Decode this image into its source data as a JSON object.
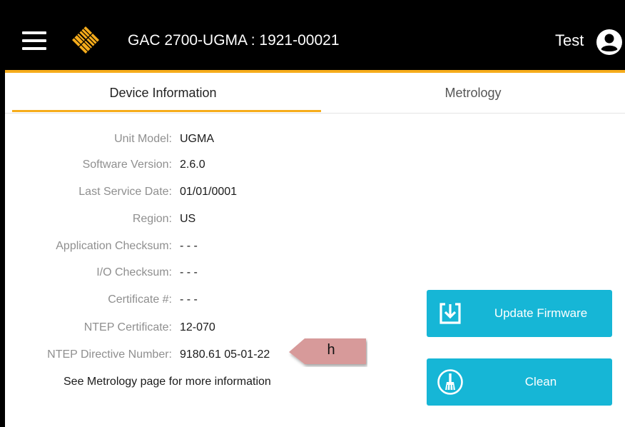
{
  "header": {
    "title": "GAC 2700-UGMA : 1921-00021",
    "user": "Test",
    "menu_icon": "hamburger-menu-icon",
    "logo_icon": "gac-logo-icon",
    "user_icon": "user-account-icon",
    "accent_color": "#f6ac1b"
  },
  "tabs": [
    {
      "label": "Device Information",
      "active": true
    },
    {
      "label": "Metrology",
      "active": false
    }
  ],
  "device_info": [
    {
      "label": "Unit Model:",
      "value": "UGMA"
    },
    {
      "label": "Software Version:",
      "value": "2.6.0"
    },
    {
      "label": "Last Service Date:",
      "value": "01/01/0001"
    },
    {
      "label": "Region:",
      "value": "US"
    },
    {
      "label": "Application Checksum:",
      "value": "- - -"
    },
    {
      "label": "I/O Checksum:",
      "value": "- - -"
    },
    {
      "label": "Certificate #:",
      "value": "- - -"
    },
    {
      "label": "NTEP Certificate:",
      "value": "12-070"
    },
    {
      "label": "NTEP Directive Number:",
      "value": "9180.61 05-01-22"
    }
  ],
  "see_more": "See Metrology page for more information",
  "buttons": {
    "update_firmware": {
      "label": "Update Firmware",
      "icon": "download-icon"
    },
    "clean": {
      "label": "Clean",
      "icon": "broom-icon"
    },
    "color": "#16b6d6"
  },
  "annotation": {
    "label": "h",
    "color": "#d79a9a"
  }
}
